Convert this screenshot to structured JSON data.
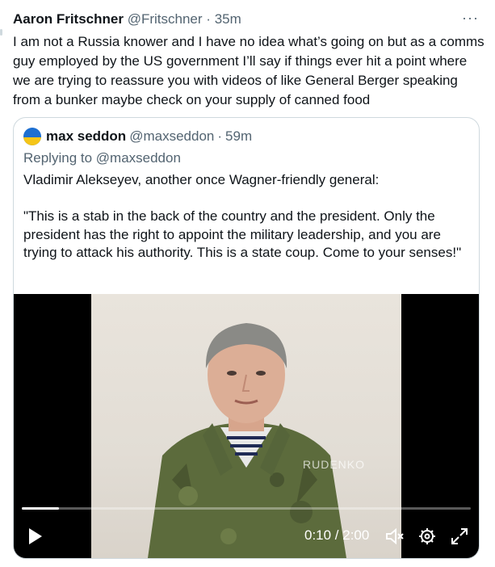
{
  "tweet": {
    "author_name": "Aaron Fritschner",
    "author_handle": "@Fritschner",
    "separator": "·",
    "time": "35m",
    "more": "···",
    "text": "I am not a Russia knower and I have no idea what’s going on but as a comms guy employed by the US government I’ll say if things ever hit a point where we are trying to reassure you with videos of like General Berger speaking from a bunker maybe check on your supply of canned food"
  },
  "quoted": {
    "author_name": "max seddon",
    "author_handle": "@maxseddon",
    "separator": "·",
    "time": "59m",
    "replying_to": "Replying to @maxseddon",
    "text": "Vladimir Alekseyev, another once Wagner-friendly general:\n\n\"This is a stab in the back of the country and the president. Only the president has the right to appoint the military leadership, and you are trying to attack his authority. This is a state coup. Come to your senses!\"",
    "avatar_icon": "ukraine-flag-avatar",
    "avatar_colors": [
      "#1d6fd1",
      "#f5c518"
    ]
  },
  "video": {
    "watermark": "RUDENKO",
    "timecode": "0:10 / 2:00",
    "progress": 0.083,
    "icons": [
      "play-icon",
      "mute-icon",
      "settings-icon",
      "fullscreen-icon"
    ]
  }
}
